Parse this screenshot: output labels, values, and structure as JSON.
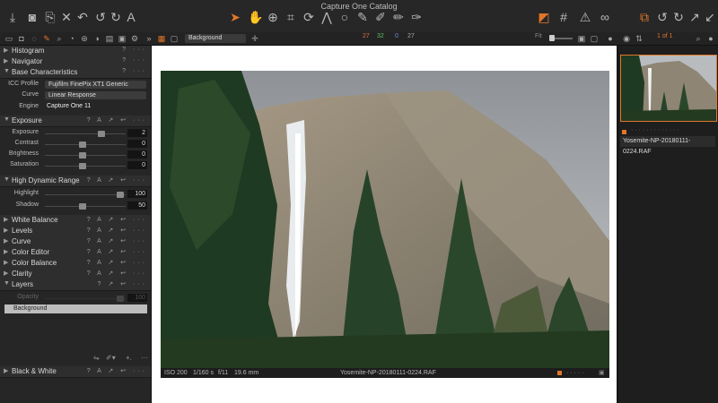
{
  "window": {
    "title": "Capture One Catalog"
  },
  "toolbar": {
    "preset": "Background",
    "counts": {
      "red": "27",
      "green": "32",
      "blue": "0",
      "gray": "27"
    },
    "fit_label": "Fit",
    "page_counter": "1 of 1"
  },
  "panel": {
    "histogram": "Histogram",
    "navigator": "Navigator",
    "base_characteristics": "Base Characteristics",
    "icc_label": "ICC Profile",
    "icc_value": "Fujifilm FinePix XT1 Generic",
    "curve_label": "Curve",
    "curve_value": "Linear Response",
    "engine_label": "Engine",
    "engine_value": "Capture One 11",
    "exposure_section": "Exposure",
    "exposure_label": "Exposure",
    "exposure_value": "2",
    "contrast_label": "Contrast",
    "contrast_value": "0",
    "brightness_label": "Brightness",
    "brightness_value": "0",
    "saturation_label": "Saturation",
    "saturation_value": "0",
    "hdr_section": "High Dynamic Range",
    "highlight_label": "Highlight",
    "highlight_value": "100",
    "shadow_label": "Shadow",
    "shadow_value": "50",
    "white_balance": "White Balance",
    "levels": "Levels",
    "curve_section": "Curve",
    "color_editor": "Color Editor",
    "color_balance": "Color Balance",
    "clarity": "Clarity",
    "layers": "Layers",
    "opacity_label": "Opacity",
    "opacity_value": "100",
    "layer_name": "Background",
    "black_white": "Black & White"
  },
  "viewer": {
    "iso": "ISO 200",
    "shutter": "1/160 s",
    "aperture": "f/11",
    "focal": "19.6 mm",
    "filename": "Yosemite-NP-20180111-0224.RAF"
  },
  "browser": {
    "filename": "Yosemite-NP-20180111-0224.RAF"
  },
  "colors": {
    "accent": "#e0762a"
  }
}
